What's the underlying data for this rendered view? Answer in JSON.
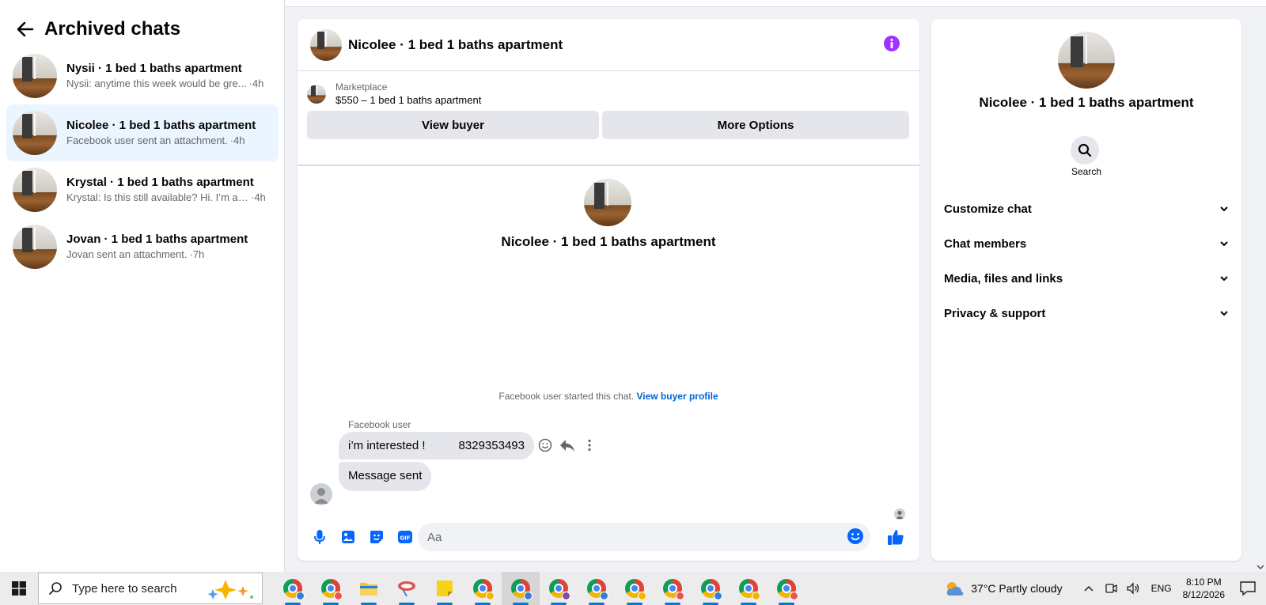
{
  "sidebar": {
    "title": "Archived chats",
    "chats": [
      {
        "name": "Nysii · 1 bed 1 baths apartment",
        "preview": "Nysii: anytime this week would be gre...",
        "time": "·4h"
      },
      {
        "name": "Nicolee · 1 bed 1 baths apartment",
        "preview": "Facebook user sent an attachment.",
        "time": "·4h"
      },
      {
        "name": "Krystal · 1 bed 1 baths apartment",
        "preview": "Krystal: Is this still available? Hi. I’m a ...",
        "time": "·4h"
      },
      {
        "name": "Jovan · 1 bed 1 baths apartment",
        "preview": "Jovan sent an attachment.",
        "time": "·7h"
      }
    ]
  },
  "conversation": {
    "title": "Nicolee · 1 bed 1 baths apartment",
    "marketplace": {
      "label": "Marketplace",
      "listing": "$550 – 1 bed 1 baths apartment",
      "view_buyer": "View buyer",
      "more_options": "More Options"
    },
    "intro_name": "Nicolee · 1 bed 1 baths apartment",
    "started_text": "Facebook user started this chat.",
    "view_profile": "View buyer profile",
    "sender_label": "Facebook user",
    "messages": [
      {
        "text": "i’m interested !",
        "phone": "8329353493"
      },
      {
        "text": "Message sent"
      }
    ],
    "composer_placeholder": "Aa"
  },
  "info_panel": {
    "name": "Nicolee · 1 bed 1 baths apartment",
    "search_label": "Search",
    "sections": [
      "Customize chat",
      "Chat members",
      "Media, files and links",
      "Privacy & support"
    ]
  },
  "taskbar": {
    "search_placeholder": "Type here to search",
    "weather": "37°C  Partly cloudy",
    "language": "ENG",
    "time": "8:10 PM",
    "date": "8/12/2026",
    "app_badges": [
      "#3a7bd5",
      "#ef5350",
      null,
      null,
      null,
      "#f5b400",
      "#3a7bd5",
      "#8e44ad",
      "#3a7bd5",
      "#f5b400",
      "#ef5350",
      "#3a7bd5",
      "#f5b400",
      "#ef5350"
    ]
  },
  "colors": {
    "accent": "#0866ff",
    "active_chat_bg": "#ebf5ff",
    "info_icon": "#a033ff"
  }
}
